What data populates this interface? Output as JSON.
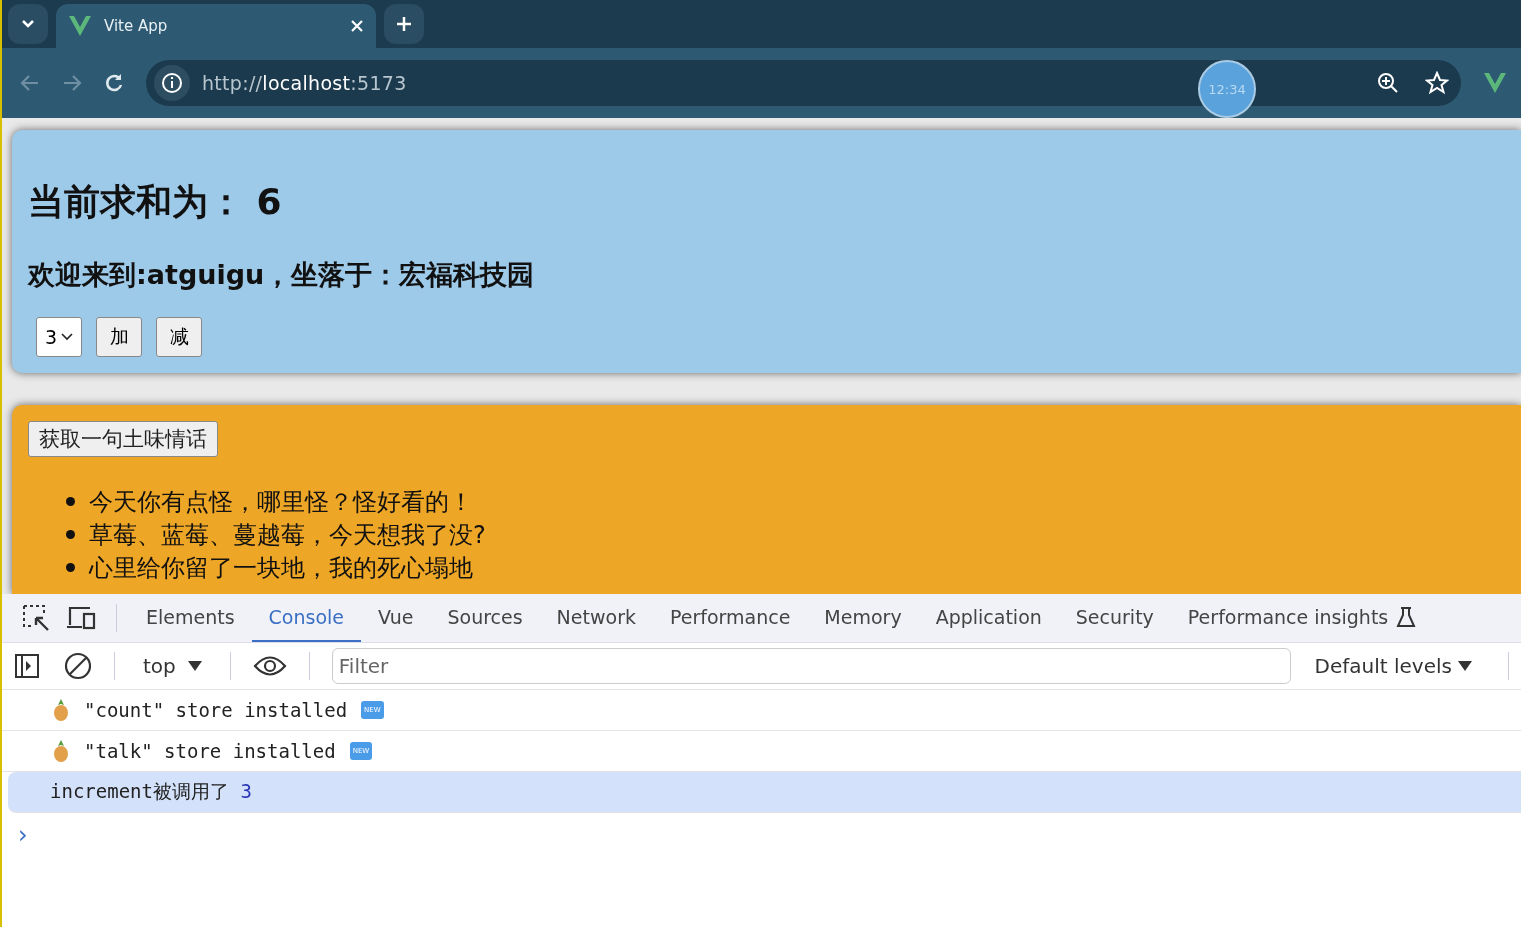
{
  "browser": {
    "tab": {
      "title": "Vite App",
      "selected": true
    },
    "url_scheme": "http://",
    "url_host": "localhost",
    "url_port": ":5173",
    "recorder_time": "12:34"
  },
  "page": {
    "sum_card": {
      "heading_label": "当前求和为：",
      "heading_value": "6",
      "welcome": "欢迎来到:atguigu，坐落于：宏福科技园",
      "select_value": "3",
      "buttons": [
        "加",
        "减"
      ]
    },
    "talk_card": {
      "button": "获取一句土味情话",
      "items": [
        "今天你有点怪，哪里怪？怪好看的！",
        "草莓、蓝莓、蔓越莓，今天想我了没?",
        "心里给你留了一块地，我的死心塌地"
      ]
    }
  },
  "devtools": {
    "tabs": [
      {
        "label": "Elements",
        "selected": false
      },
      {
        "label": "Console",
        "selected": true
      },
      {
        "label": "Vue",
        "selected": false
      },
      {
        "label": "Sources",
        "selected": false
      },
      {
        "label": "Network",
        "selected": false
      },
      {
        "label": "Performance",
        "selected": false
      },
      {
        "label": "Memory",
        "selected": false
      },
      {
        "label": "Application",
        "selected": false
      },
      {
        "label": "Security",
        "selected": false
      },
      {
        "label": "Performance insights",
        "selected": false
      }
    ],
    "context": "top",
    "filter_placeholder": "Filter",
    "levels": "Default levels",
    "messages": [
      {
        "kind": "store",
        "text": "\"count\" store installed",
        "badge": "NEW",
        "selected": false
      },
      {
        "kind": "store",
        "text": "\"talk\" store installed",
        "badge": "NEW",
        "selected": false
      },
      {
        "kind": "log",
        "text": "increment被调用了",
        "value": "3",
        "selected": true
      }
    ],
    "prompt": "›"
  }
}
